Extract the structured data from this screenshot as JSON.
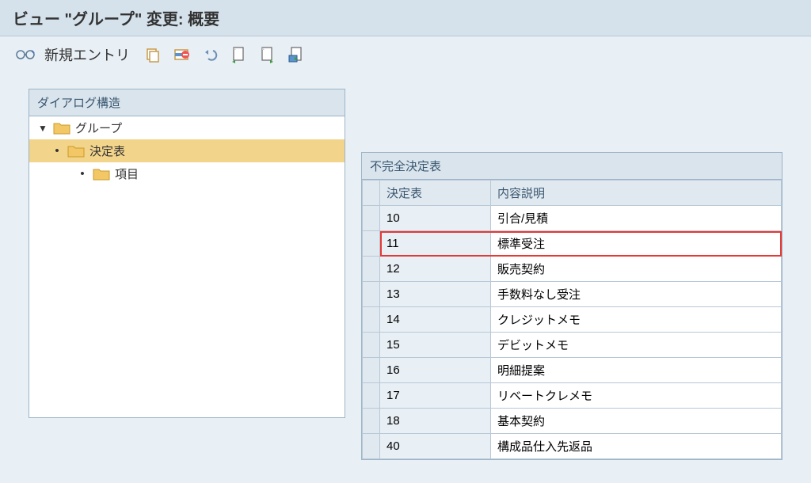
{
  "header": {
    "title": "ビュー \"グループ\" 変更: 概要"
  },
  "toolbar": {
    "new_entry_label": "新規エントリ"
  },
  "tree": {
    "header": "ダイアログ構造",
    "node_group": "グループ",
    "node_decision": "決定表",
    "node_item": "項目"
  },
  "table": {
    "title": "不完全決定表",
    "col_code": "決定表",
    "col_desc": "内容説明",
    "rows": [
      {
        "code": "10",
        "desc": "引合/見積"
      },
      {
        "code": "11",
        "desc": "標準受注"
      },
      {
        "code": "12",
        "desc": "販売契約"
      },
      {
        "code": "13",
        "desc": "手数料なし受注"
      },
      {
        "code": "14",
        "desc": "クレジットメモ"
      },
      {
        "code": "15",
        "desc": "デビットメモ"
      },
      {
        "code": "16",
        "desc": "明細提案"
      },
      {
        "code": "17",
        "desc": "リベートクレメモ"
      },
      {
        "code": "18",
        "desc": "基本契約"
      },
      {
        "code": "40",
        "desc": "構成品仕入先返品"
      }
    ],
    "highlighted_index": 1
  }
}
